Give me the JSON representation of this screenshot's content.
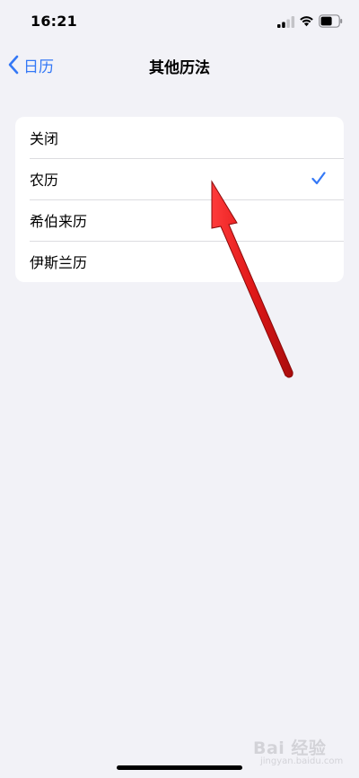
{
  "status_bar": {
    "time": "16:21",
    "icons": [
      "cellular-signal-icon",
      "wifi-icon",
      "battery-icon"
    ]
  },
  "nav": {
    "back_label": "日历",
    "title": "其他历法"
  },
  "calendar_options": [
    {
      "label": "关闭",
      "selected": false
    },
    {
      "label": "农历",
      "selected": true
    },
    {
      "label": "希伯来历",
      "selected": false
    },
    {
      "label": "伊斯兰历",
      "selected": false
    }
  ],
  "watermark": {
    "text": "Bai 经验",
    "sub": "jingyan.baidu.com"
  },
  "colors": {
    "accent": "#3478f6",
    "background": "#f2f2f7",
    "annotation_arrow": "#e02020"
  }
}
